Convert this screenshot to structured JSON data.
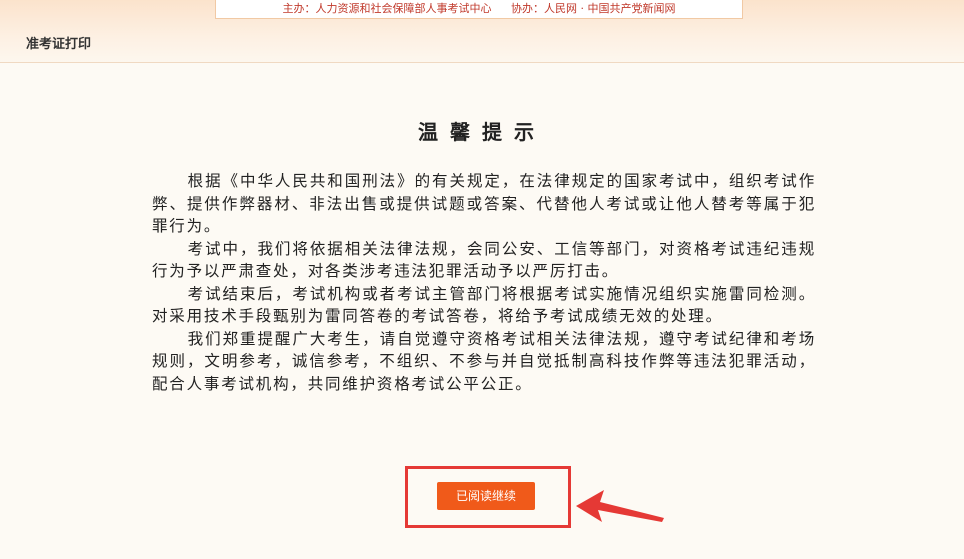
{
  "header": {
    "sponsor": "主办：人力资源和社会保障部人事考试中心",
    "co_sponsor": "协办：人民网 · 中国共产党新闻网",
    "page_title": "准考证打印"
  },
  "notice": {
    "title": "温馨提示",
    "paragraphs": [
      "根据《中华人民共和国刑法》的有关规定，在法律规定的国家考试中，组织考试作弊、提供作弊器材、非法出售或提供试题或答案、代替他人考试或让他人替考等属于犯罪行为。",
      "考试中，我们将依据相关法律法规，会同公安、工信等部门，对资格考试违纪违规行为予以严肃查处，对各类涉考违法犯罪活动予以严厉打击。",
      "考试结束后，考试机构或者考试主管部门将根据考试实施情况组织实施雷同检测。对采用技术手段甄别为雷同答卷的考试答卷，将给予考试成绩无效的处理。",
      "我们郑重提醒广大考生，请自觉遵守资格考试相关法律法规，遵守考试纪律和考场规则，文明参考，诚信参考，不组织、不参与并自觉抵制高科技作弊等违法犯罪活动，配合人事考试机构，共同维护资格考试公平公正。"
    ]
  },
  "actions": {
    "continue_label": "已阅读继续"
  },
  "colors": {
    "accent": "#f05a1a",
    "highlight": "#e53935"
  }
}
